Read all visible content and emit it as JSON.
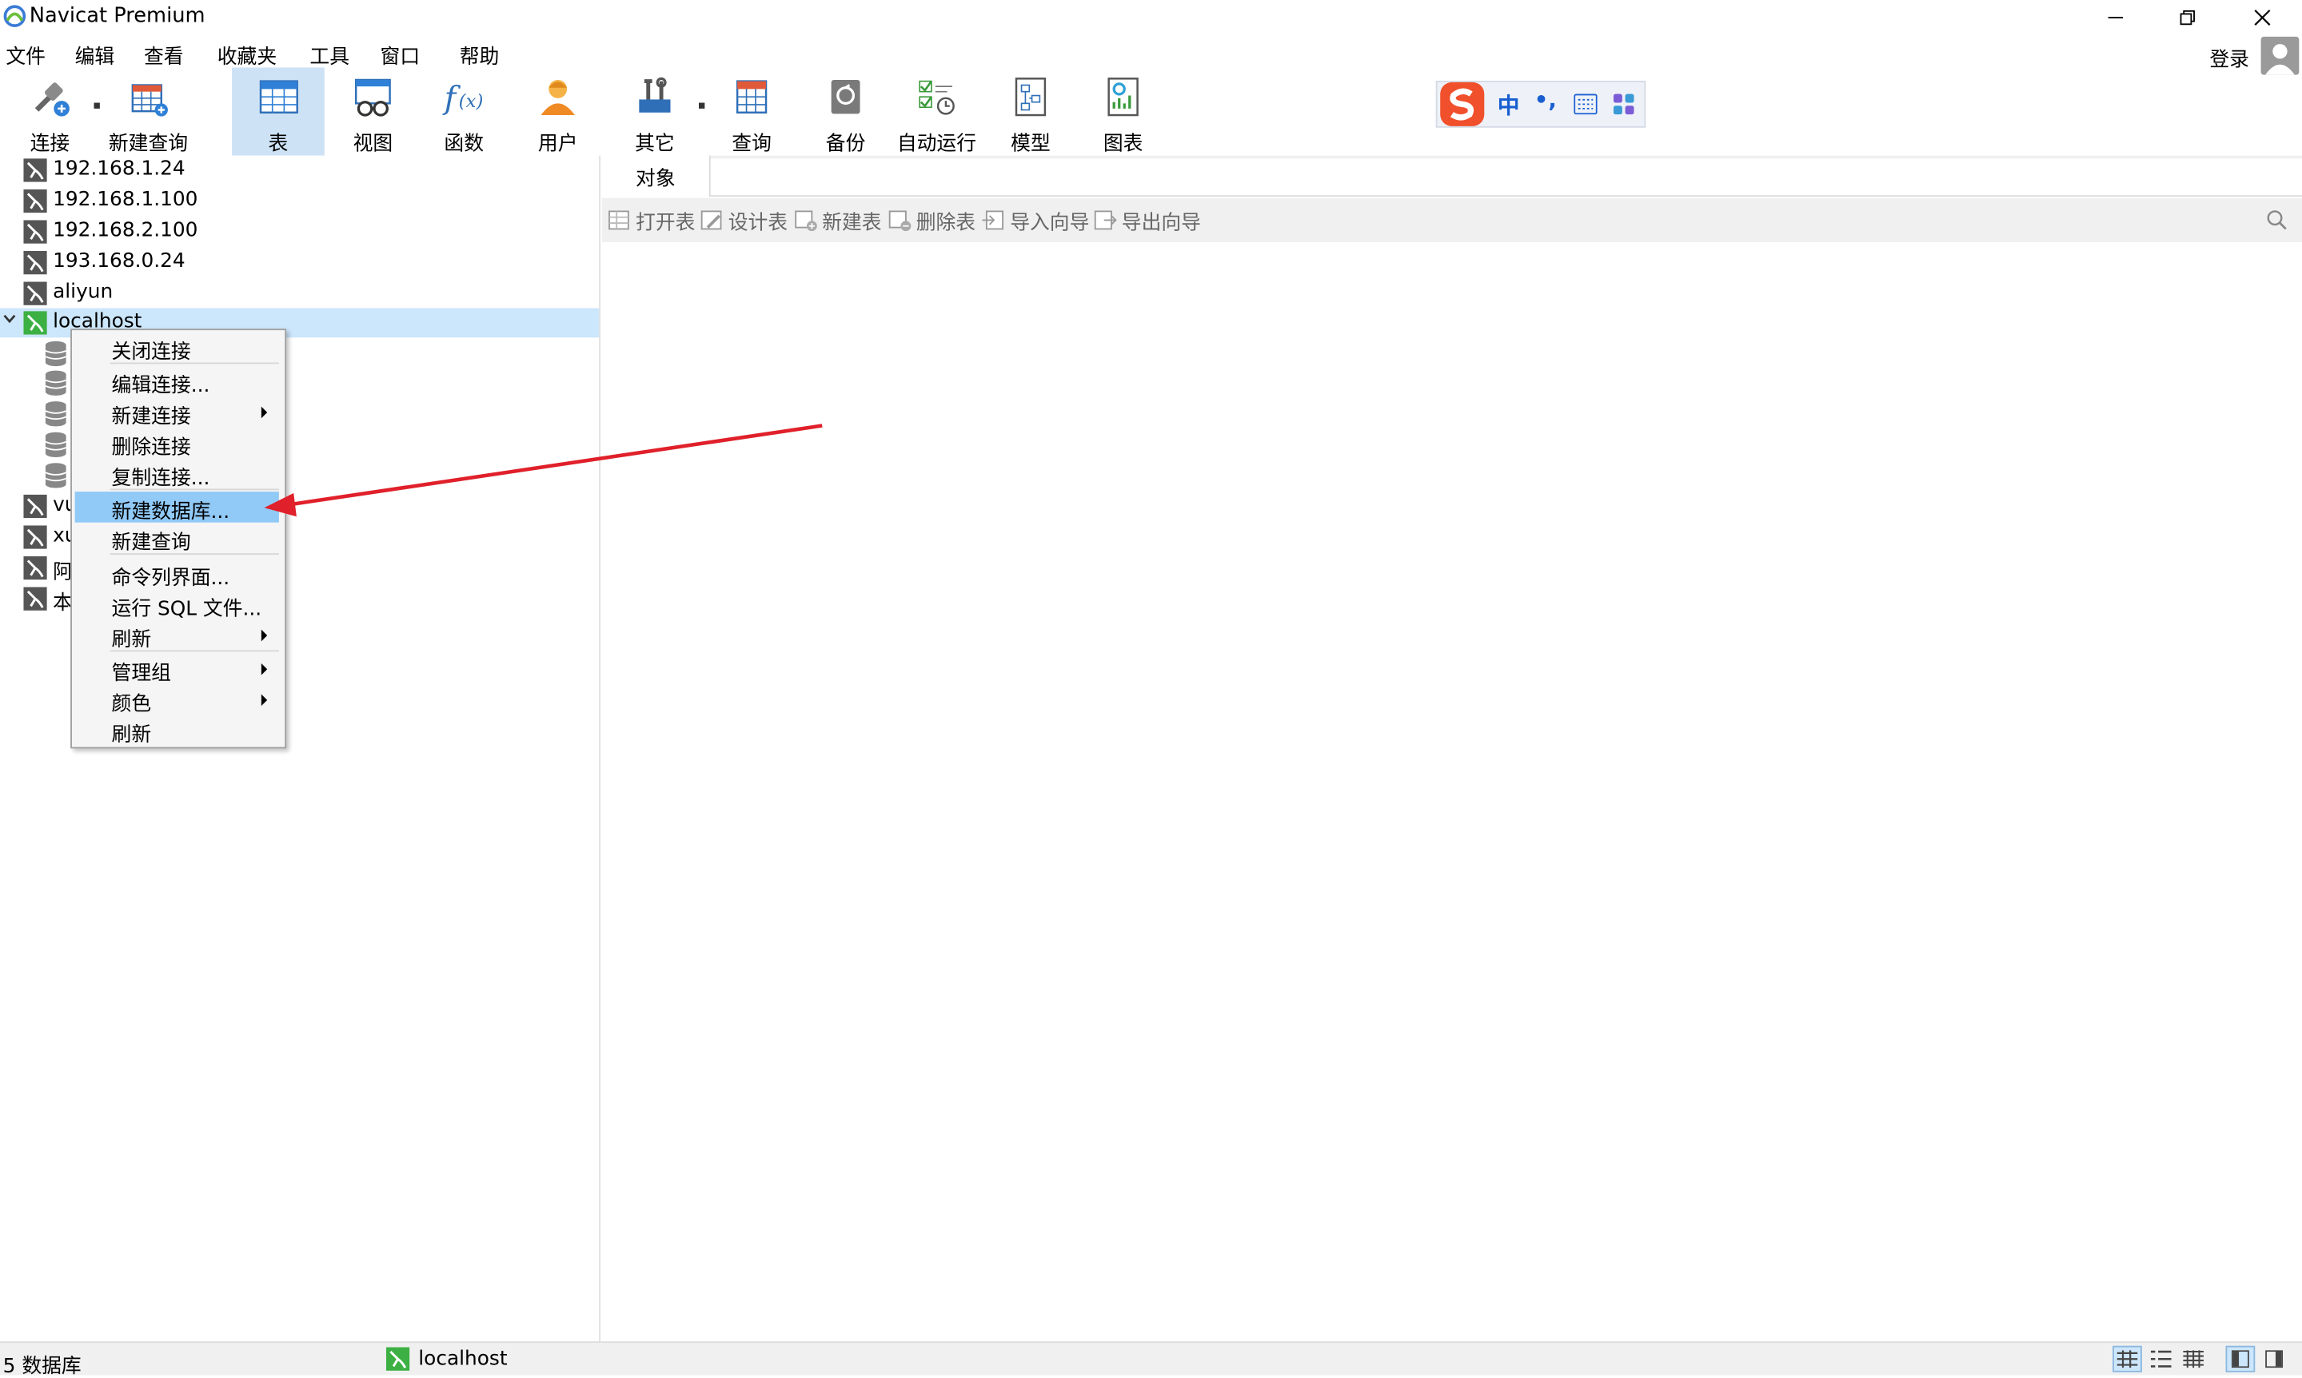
{
  "window": {
    "title": "Navicat Premium"
  },
  "menubar": {
    "items": [
      "文件",
      "编辑",
      "查看",
      "收藏夹",
      "工具",
      "窗口",
      "帮助"
    ],
    "login": "登录"
  },
  "toolbar": {
    "items": [
      {
        "label": "连接",
        "icon": "connect-icon"
      },
      {
        "label": "新建查询",
        "icon": "new-query-icon"
      },
      {
        "label": "表",
        "icon": "table-icon",
        "active": true
      },
      {
        "label": "视图",
        "icon": "view-icon"
      },
      {
        "label": "函数",
        "icon": "function-icon"
      },
      {
        "label": "用户",
        "icon": "user-icon"
      },
      {
        "label": "其它",
        "icon": "tools-icon"
      },
      {
        "label": "查询",
        "icon": "query-icon"
      },
      {
        "label": "备份",
        "icon": "backup-icon"
      },
      {
        "label": "自动运行",
        "icon": "schedule-icon"
      },
      {
        "label": "模型",
        "icon": "model-icon"
      },
      {
        "label": "图表",
        "icon": "chart-icon"
      }
    ],
    "ime": {
      "mode": "中",
      "punct": "•,"
    }
  },
  "tree": {
    "connections_top": [
      "192.168.1.24",
      "192.168.1.100",
      "192.168.2.100",
      "193.168.0.24",
      "aliyun"
    ],
    "selected": "localhost",
    "connections_bottom": [
      "vu",
      "xu",
      "阿",
      "本"
    ]
  },
  "context_menu": {
    "items": [
      {
        "label": "关闭连接"
      },
      {
        "label": "编辑连接..."
      },
      {
        "label": "新建连接",
        "submenu": true
      },
      {
        "label": "删除连接"
      },
      {
        "label": "复制连接..."
      },
      {
        "label": "新建数据库...",
        "highlighted": true
      },
      {
        "label": "新建查询"
      },
      {
        "label": "命令列界面..."
      },
      {
        "label": "运行 SQL 文件..."
      },
      {
        "label": "刷新",
        "submenu": true
      },
      {
        "label": "管理组",
        "submenu": true
      },
      {
        "label": "颜色",
        "submenu": true
      },
      {
        "label": "刷新"
      }
    ]
  },
  "object_tab": {
    "label": "对象"
  },
  "object_toolbar": {
    "buttons": [
      "打开表",
      "设计表",
      "新建表",
      "删除表",
      "导入向导",
      "导出向导"
    ]
  },
  "statusbar": {
    "db_count": "5 数据库",
    "connection": "localhost"
  },
  "colors": {
    "selection": "#cce6fb",
    "menu_highlight": "#91c9f7",
    "annotation_arrow": "#e0202a",
    "connection_active": "#3cb043"
  }
}
